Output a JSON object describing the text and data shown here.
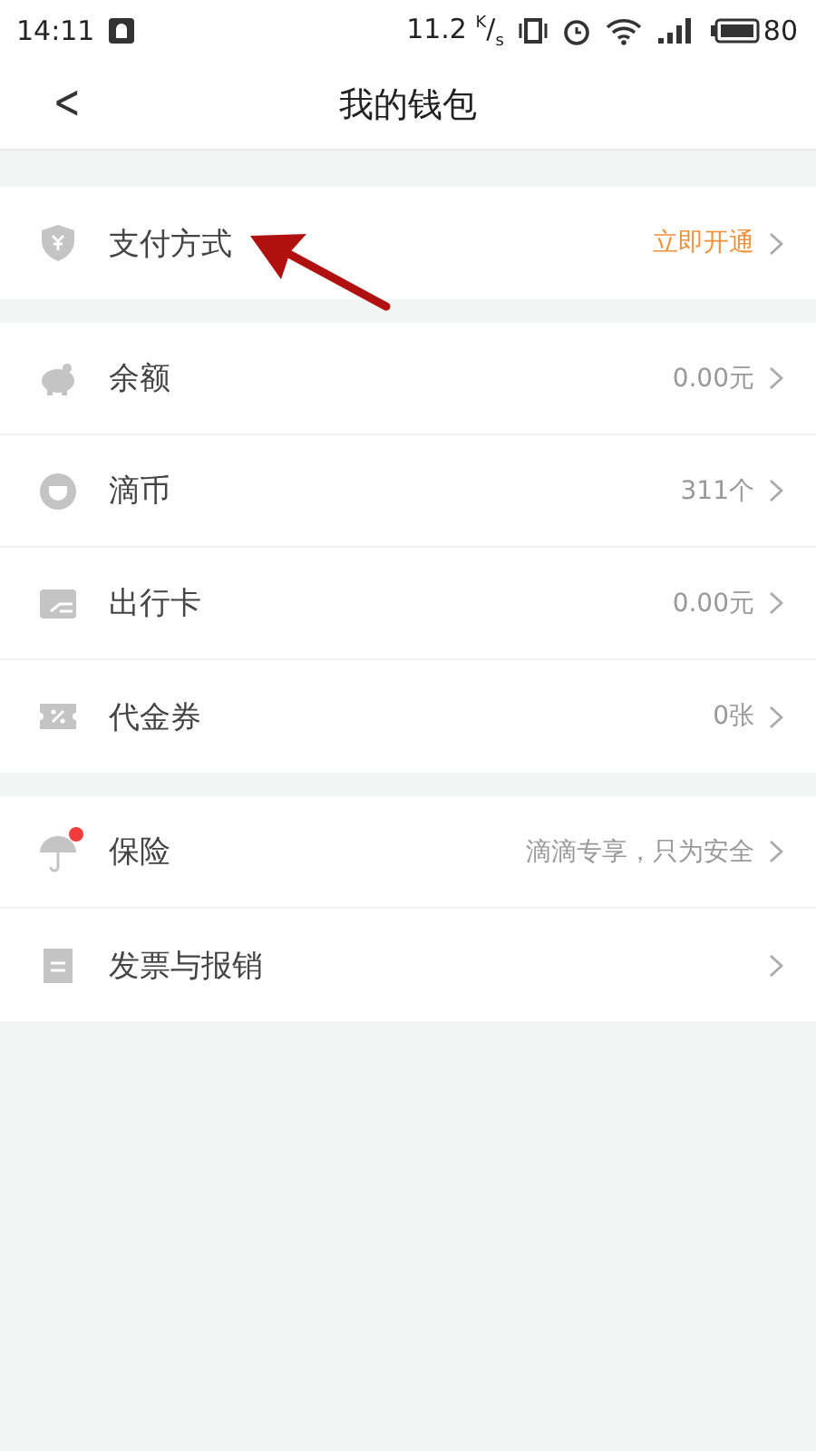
{
  "status_bar": {
    "time": "14:11",
    "network_speed": "11.2 $^{K}$/$_{s}$",
    "battery": "80"
  },
  "header": {
    "back": "<",
    "title": "我的钱包"
  },
  "groups": [
    {
      "items": [
        {
          "kind": "shield",
          "label": "支付方式",
          "value": "立即开通",
          "highlight": true,
          "badge": false
        }
      ]
    },
    {
      "items": [
        {
          "kind": "piggy",
          "label": "余额",
          "value": "0.00元",
          "highlight": false,
          "badge": false
        },
        {
          "kind": "coin",
          "label": "滴币",
          "value": "311个",
          "highlight": false,
          "badge": false
        },
        {
          "kind": "card",
          "label": "出行卡",
          "value": "0.00元",
          "highlight": false,
          "badge": false
        },
        {
          "kind": "coupon",
          "label": "代金券",
          "value": "0张",
          "highlight": false,
          "badge": false
        }
      ]
    },
    {
      "items": [
        {
          "kind": "umbrella",
          "label": "保险",
          "value": "滴滴专享，只为安全",
          "highlight": false,
          "badge": true
        },
        {
          "kind": "receipt",
          "label": "发票与报销",
          "badge": false
        }
      ]
    }
  ]
}
